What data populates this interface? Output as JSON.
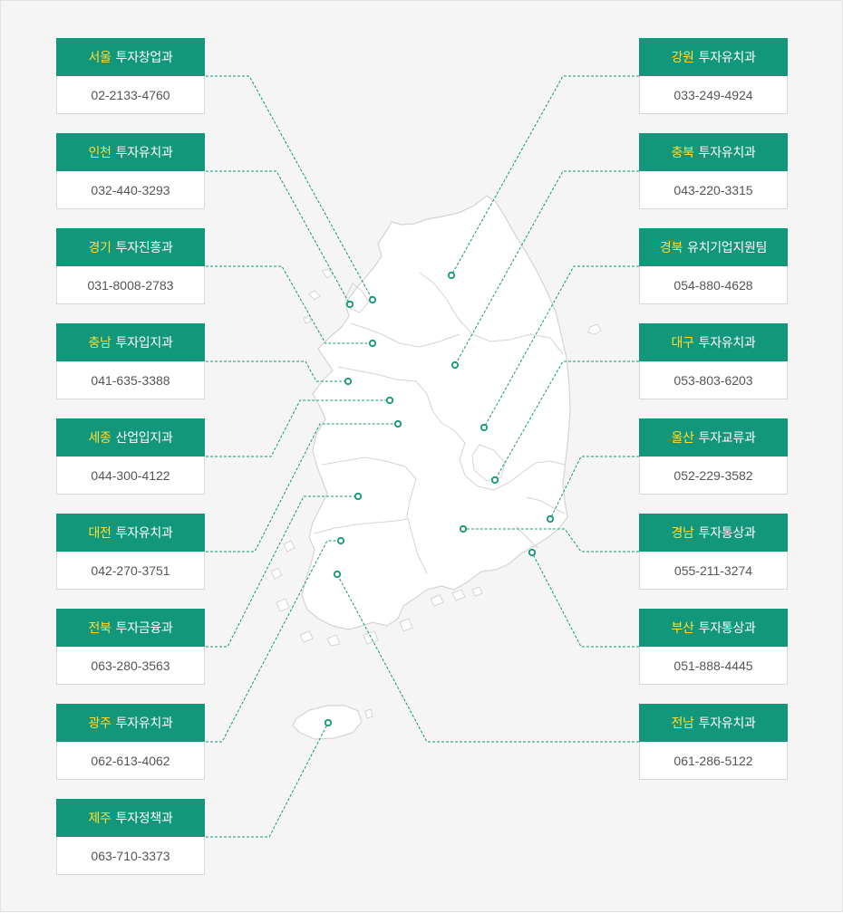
{
  "colors": {
    "header_bg": "#12977a",
    "region_text": "#ffde34",
    "dept_text": "#ffffff",
    "phone_text": "#555555",
    "leader_line": "#12977a",
    "map_fill": "#ffffff",
    "map_stroke": "#d4d4d4",
    "background": "#f5f5f5"
  },
  "offices": [
    {
      "id": "seoul",
      "region": "서울",
      "dept": "투자창업과",
      "phone": "02-2133-4760"
    },
    {
      "id": "incheon",
      "region": "인천",
      "dept": "투자유치과",
      "phone": "032-440-3293"
    },
    {
      "id": "gyeonggi",
      "region": "경기",
      "dept": "투자진흥과",
      "phone": "031-8008-2783"
    },
    {
      "id": "chungnam",
      "region": "충남",
      "dept": "투자입지과",
      "phone": "041-635-3388"
    },
    {
      "id": "sejong",
      "region": "세종",
      "dept": "산업입지과",
      "phone": "044-300-4122"
    },
    {
      "id": "daejeon",
      "region": "대전",
      "dept": "투자유치과",
      "phone": "042-270-3751"
    },
    {
      "id": "jeonbuk",
      "region": "전북",
      "dept": "투자금융과",
      "phone": "063-280-3563"
    },
    {
      "id": "gwangju",
      "region": "광주",
      "dept": "투자유치과",
      "phone": "062-613-4062"
    },
    {
      "id": "jeju",
      "region": "제주",
      "dept": "투자정책과",
      "phone": "063-710-3373"
    },
    {
      "id": "gangwon",
      "region": "강원",
      "dept": "투자유치과",
      "phone": "033-249-4924"
    },
    {
      "id": "chungbuk",
      "region": "충북",
      "dept": "투자유치과",
      "phone": "043-220-3315"
    },
    {
      "id": "gyeongbuk",
      "region": "경북",
      "dept": "유치기업지원팀",
      "phone": "054-880-4628"
    },
    {
      "id": "daegu",
      "region": "대구",
      "dept": "투자유치과",
      "phone": "053-803-6203"
    },
    {
      "id": "ulsan",
      "region": "울산",
      "dept": "투자교류과",
      "phone": "052-229-3582"
    },
    {
      "id": "gyeongnam",
      "region": "경남",
      "dept": "투자통상과",
      "phone": "055-211-3274"
    },
    {
      "id": "busan",
      "region": "부산",
      "dept": "투자통상과",
      "phone": "051-888-4445"
    },
    {
      "id": "jeonnam",
      "region": "전남",
      "dept": "투자유치과",
      "phone": "061-286-5122"
    }
  ]
}
